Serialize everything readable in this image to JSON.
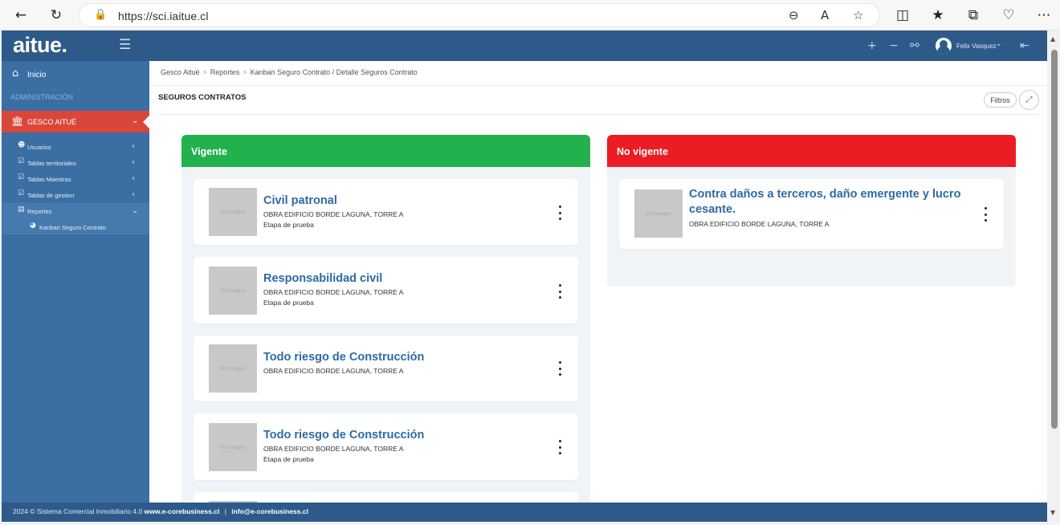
{
  "browser": {
    "url": "https://sci.iaitue.cl",
    "back_icon": "arrow-left-icon",
    "reload_icon": "reload-icon",
    "lock_icon": "lock-icon",
    "zoom_icon": "zoom-out-icon",
    "read_aloud_icon": "read-aloud-icon",
    "favorite_icon": "star-icon",
    "split_icon": "split-screen-icon",
    "favorites_icon": "favorites-icon",
    "collections_icon": "collections-icon",
    "health_icon": "browser-essentials-icon",
    "more_icon": "more-icon"
  },
  "topbar": {
    "logo": "aitue.",
    "user_name": "Felix Vasquez"
  },
  "sidebar": {
    "inicio": "Inicio",
    "section": "ADMINISTRACIÓN",
    "gesco": "GESCO AITUÉ",
    "items": [
      {
        "label": "Usuarios",
        "icon": "users-icon"
      },
      {
        "label": "Tablas territoriales",
        "icon": "checkbox-icon"
      },
      {
        "label": "Tablas Maestras",
        "icon": "checkbox-icon"
      },
      {
        "label": "Tablas de gestion",
        "icon": "checkbox-icon"
      },
      {
        "label": "Reportes",
        "icon": "bar-chart-icon"
      }
    ],
    "kanban": "Kanban Seguro Contrato"
  },
  "breadcrumb": [
    "Gesco Aitué",
    "Reportes",
    "Kanban Seguro Contrato / Detalle Seguros Contrato"
  ],
  "page": {
    "title": "SEGUROS CONTRATOS",
    "filtros": "Filtros"
  },
  "columns": {
    "vigente": {
      "title": "Vigente",
      "color": "#22b14c",
      "cards": [
        {
          "title": "Civil patronal",
          "subtitle": "OBRA EDIFICIO BORDE LAGUNA, TORRE A",
          "stage": "Etapa de prueba",
          "thumb": "Sin Imagen"
        },
        {
          "title": "Responsabilidad civil",
          "subtitle": "OBRA EDIFICIO BORDE LAGUNA, TORRE A",
          "stage": "Etapa de prueba",
          "thumb": "Sin Imagen"
        },
        {
          "title": "Todo riesgo de Construcción",
          "subtitle": "OBRA EDIFICIO BORDE LAGUNA, TORRE A",
          "stage": "",
          "thumb": "Sin Imagen"
        },
        {
          "title": "Todo riesgo de Construcción",
          "subtitle": "OBRA EDIFICIO BORDE LAGUNA, TORRE A",
          "stage": "Etapa de prueba",
          "thumb": "Sin Imagen"
        }
      ]
    },
    "no_vigente": {
      "title": "No vigente",
      "color": "#ec1c24",
      "cards": [
        {
          "title": "Contra daños a terceros, daño emergente y lucro cesante.",
          "subtitle": "OBRA EDIFICIO BORDE LAGUNA, TORRE A",
          "thumb": "Sin Imagen"
        }
      ]
    }
  },
  "footer": {
    "text": "2024 © Sistema Comercial Inmobiliario 4.0",
    "site": "www.e-corebusiness.cl",
    "sep": "|",
    "email": "info@e-corebusiness.cl"
  }
}
